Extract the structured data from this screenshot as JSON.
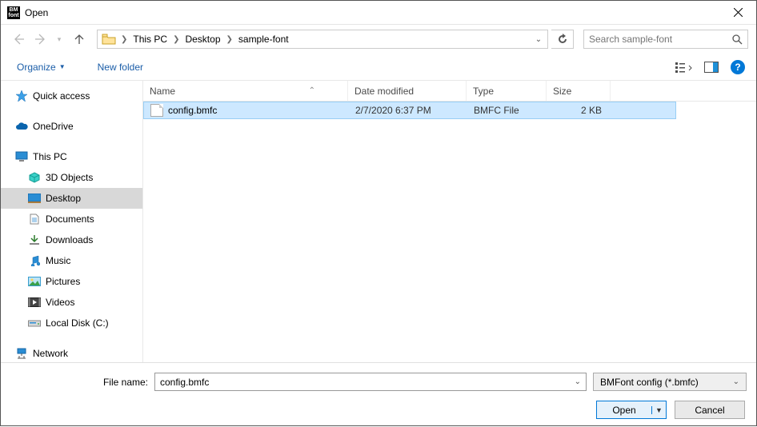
{
  "window": {
    "title": "Open"
  },
  "breadcrumbs": {
    "root": "This PC",
    "mid": "Desktop",
    "leaf": "sample-font"
  },
  "search": {
    "placeholder": "Search sample-font"
  },
  "toolbar": {
    "organize": "Organize",
    "newfolder": "New folder"
  },
  "sidebar": {
    "quick": "Quick access",
    "onedrive": "OneDrive",
    "thispc": "This PC",
    "objects3d": "3D Objects",
    "desktop": "Desktop",
    "documents": "Documents",
    "downloads": "Downloads",
    "music": "Music",
    "pictures": "Pictures",
    "videos": "Videos",
    "localdisk": "Local Disk (C:)",
    "network": "Network"
  },
  "columns": {
    "name": "Name",
    "date": "Date modified",
    "type": "Type",
    "size": "Size"
  },
  "files": [
    {
      "name": "config.bmfc",
      "date": "2/7/2020 6:37 PM",
      "type": "BMFC File",
      "size": "2 KB"
    }
  ],
  "footer": {
    "filename_label": "File name:",
    "filename_value": "config.bmfc",
    "filter": "BMFont config (*.bmfc)",
    "open": "Open",
    "cancel": "Cancel"
  }
}
